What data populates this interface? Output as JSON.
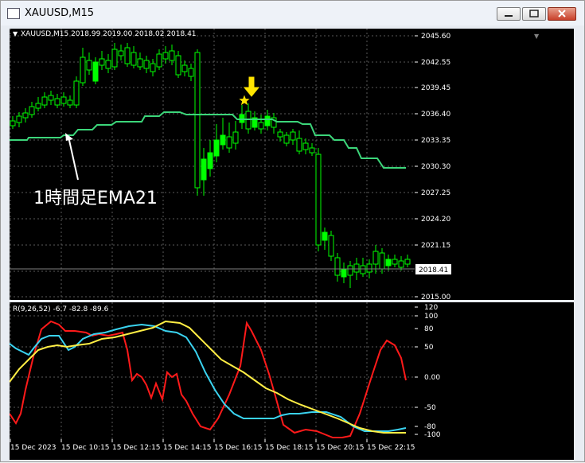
{
  "window": {
    "title": "XAUUSD,M15",
    "icons": [
      "app-icon",
      "minimize-icon",
      "maximize-icon",
      "close-icon"
    ]
  },
  "main_chart": {
    "info": "XAUUSD,M15  2018.99 2019.00 2018.02 2018.41",
    "price_labels": [
      "2045.60",
      "2042.55",
      "2039.45",
      "2036.40",
      "2033.35",
      "2030.30",
      "2027.25",
      "2024.20",
      "2021.15",
      "2018.41",
      "2015.00"
    ],
    "current_price": "2018.41",
    "annotation": "1時間足EMA21",
    "colors": {
      "bull": "#00ff00",
      "bear": "#000000",
      "ema": "#3cd67a",
      "arrow": "#ffe400"
    }
  },
  "indicator": {
    "info": "R(9,26,52) -6.7 -82.8 -89.6",
    "scale_labels": [
      "120",
      "100",
      "80",
      "50",
      "0.00",
      "-50",
      "-80",
      "-100"
    ],
    "colors": {
      "red": "#ff1a1a",
      "cyan": "#3ad3f0",
      "yellow": "#ffee44"
    }
  },
  "time_labels": [
    "15 Dec 2023",
    "15 Dec 10:15",
    "15 Dec 12:15",
    "15 Dec 14:15",
    "15 Dec 16:15",
    "15 Dec 18:15",
    "15 Dec 20:15",
    "15 Dec 22:15"
  ]
}
